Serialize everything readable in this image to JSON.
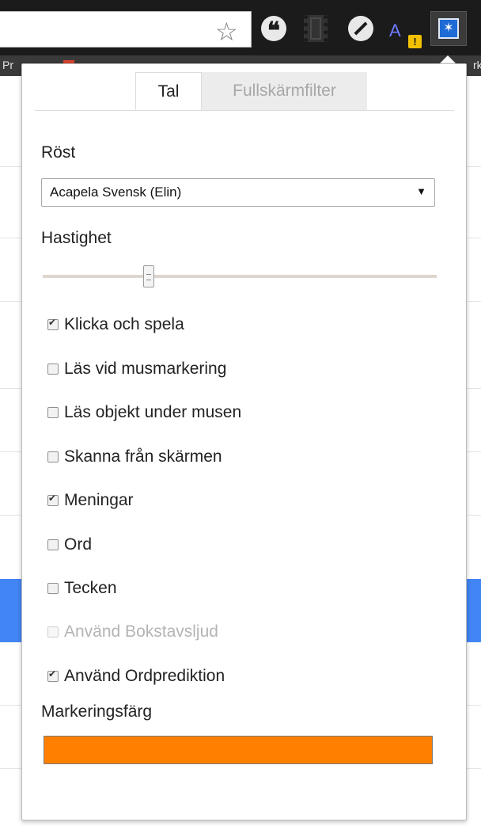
{
  "browser": {
    "bookmark_left": "Pr",
    "bookmark_right": "rk",
    "ext_a_label": "A",
    "ext_a_badge": "!",
    "ext_read_symbol": "✶"
  },
  "popup": {
    "tabs": [
      {
        "label": "Tal",
        "active": true
      },
      {
        "label": "Fullskärmfilter",
        "active": false
      }
    ],
    "voice_label": "Röst",
    "voice_selected": "Acapela Svensk (Elin)",
    "speed_label": "Hastighet",
    "speed_value": 0.27,
    "options": [
      {
        "label": "Klicka och spela",
        "checked": true,
        "disabled": false
      },
      {
        "label": "Läs vid musmarkering",
        "checked": false,
        "disabled": false
      },
      {
        "label": "Läs objekt under musen",
        "checked": false,
        "disabled": false
      },
      {
        "label": "Skanna från skärmen",
        "checked": false,
        "disabled": false
      },
      {
        "label": "Meningar",
        "checked": true,
        "disabled": false
      },
      {
        "label": "Ord",
        "checked": false,
        "disabled": false
      },
      {
        "label": "Tecken",
        "checked": false,
        "disabled": false
      },
      {
        "label": "Använd Bokstavsljud",
        "checked": false,
        "disabled": true
      },
      {
        "label": "Använd Ordprediktion",
        "checked": true,
        "disabled": false
      }
    ],
    "highlight_color_label": "Markeringsfärg",
    "highlight_color": "#ff8000"
  }
}
